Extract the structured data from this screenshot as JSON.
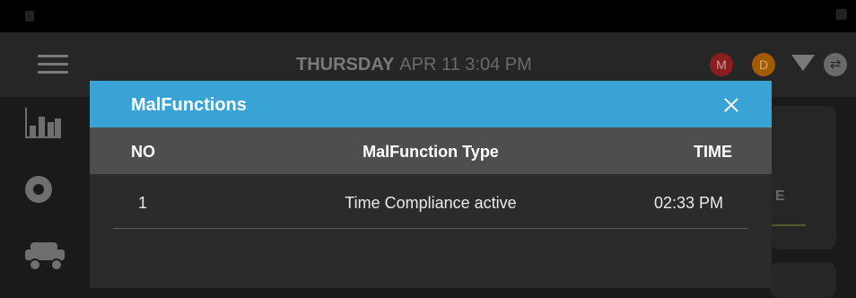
{
  "header": {
    "day": "THURSDAY",
    "datetime": "APR 11 3:04 PM",
    "badge_m": "M",
    "badge_d": "D"
  },
  "icons": {
    "menu": "hamburger-menu-icon",
    "wifi": "wifi-icon",
    "sync": "sync-icon",
    "sidebar": [
      "bar-chart-icon",
      "circle-logo-icon",
      "truck-icon"
    ]
  },
  "colors": {
    "dialog_header": "#3aa3d6",
    "table_head": "#4e4e4e",
    "badge_m": "#8c1d1d",
    "badge_d": "#a05a00"
  },
  "background_card": {
    "label": "E"
  },
  "dialog": {
    "title": "MalFunctions",
    "columns": {
      "no": "NO",
      "type": "MalFunction Type",
      "time": "TIME"
    },
    "rows": [
      {
        "no": "1",
        "type": "Time Compliance active",
        "time": "02:33 PM"
      }
    ]
  }
}
